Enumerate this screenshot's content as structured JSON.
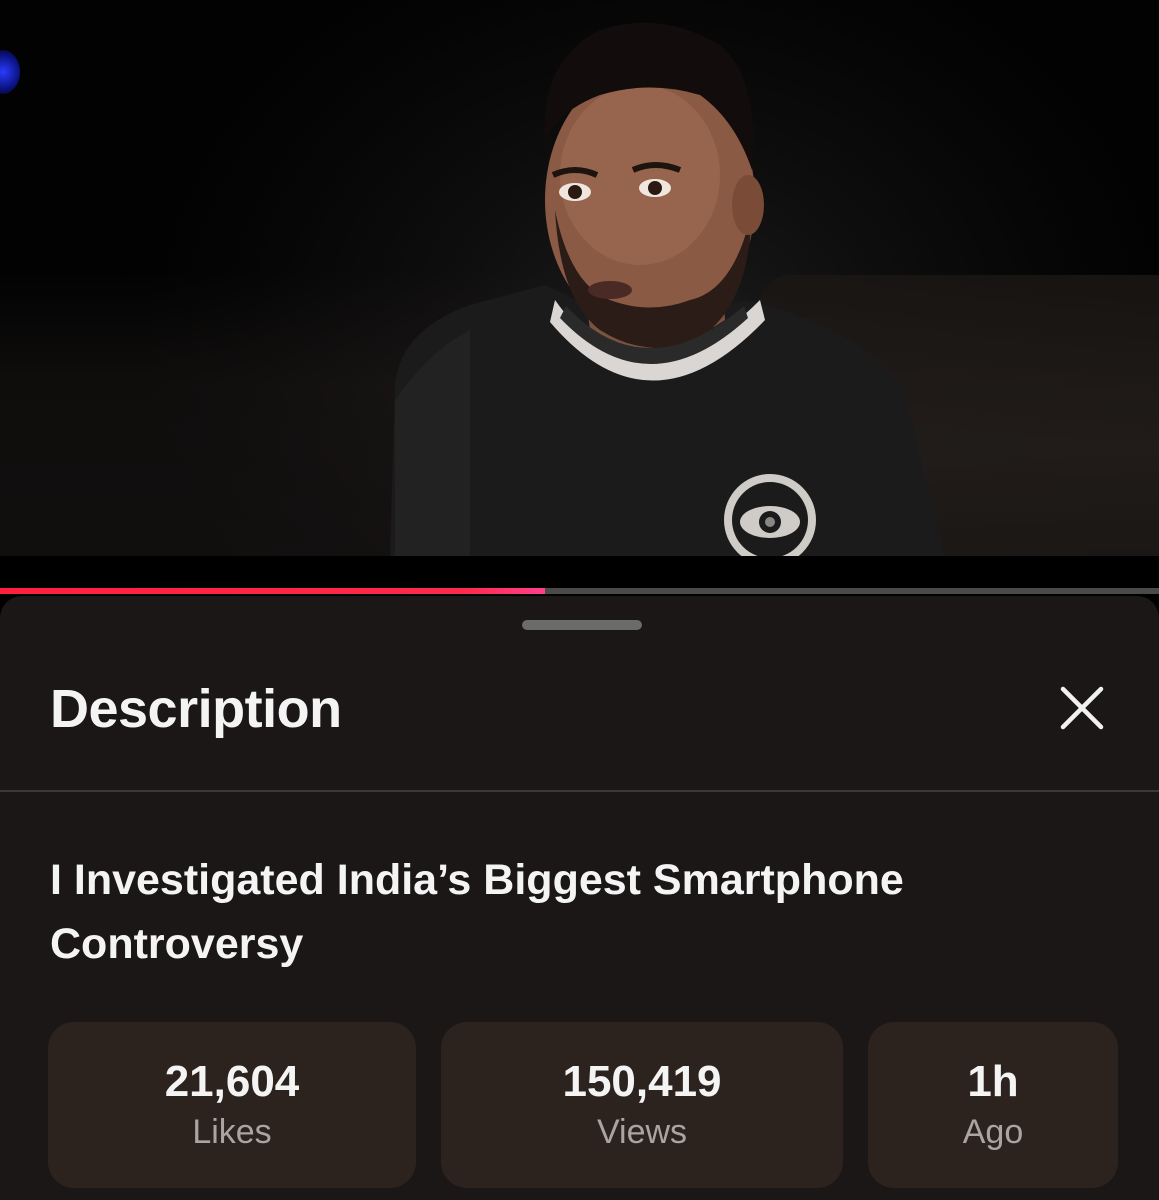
{
  "player": {
    "progress_fraction": 0.47,
    "colors": {
      "progress_played": "#ff2a4a",
      "progress_remaining": "#4a4a4a"
    }
  },
  "description_sheet": {
    "title": "Description",
    "close_icon": "close-icon",
    "video_title": "I Investigated India’s Biggest Smartphone Controversy",
    "stats": [
      {
        "value": "21,604",
        "label": "Likes"
      },
      {
        "value": "150,419",
        "label": "Views"
      },
      {
        "value": "1h",
        "label": "Ago"
      }
    ],
    "colors": {
      "sheet_bg": "#1a1716",
      "stat_bg": "#2c231f"
    }
  }
}
